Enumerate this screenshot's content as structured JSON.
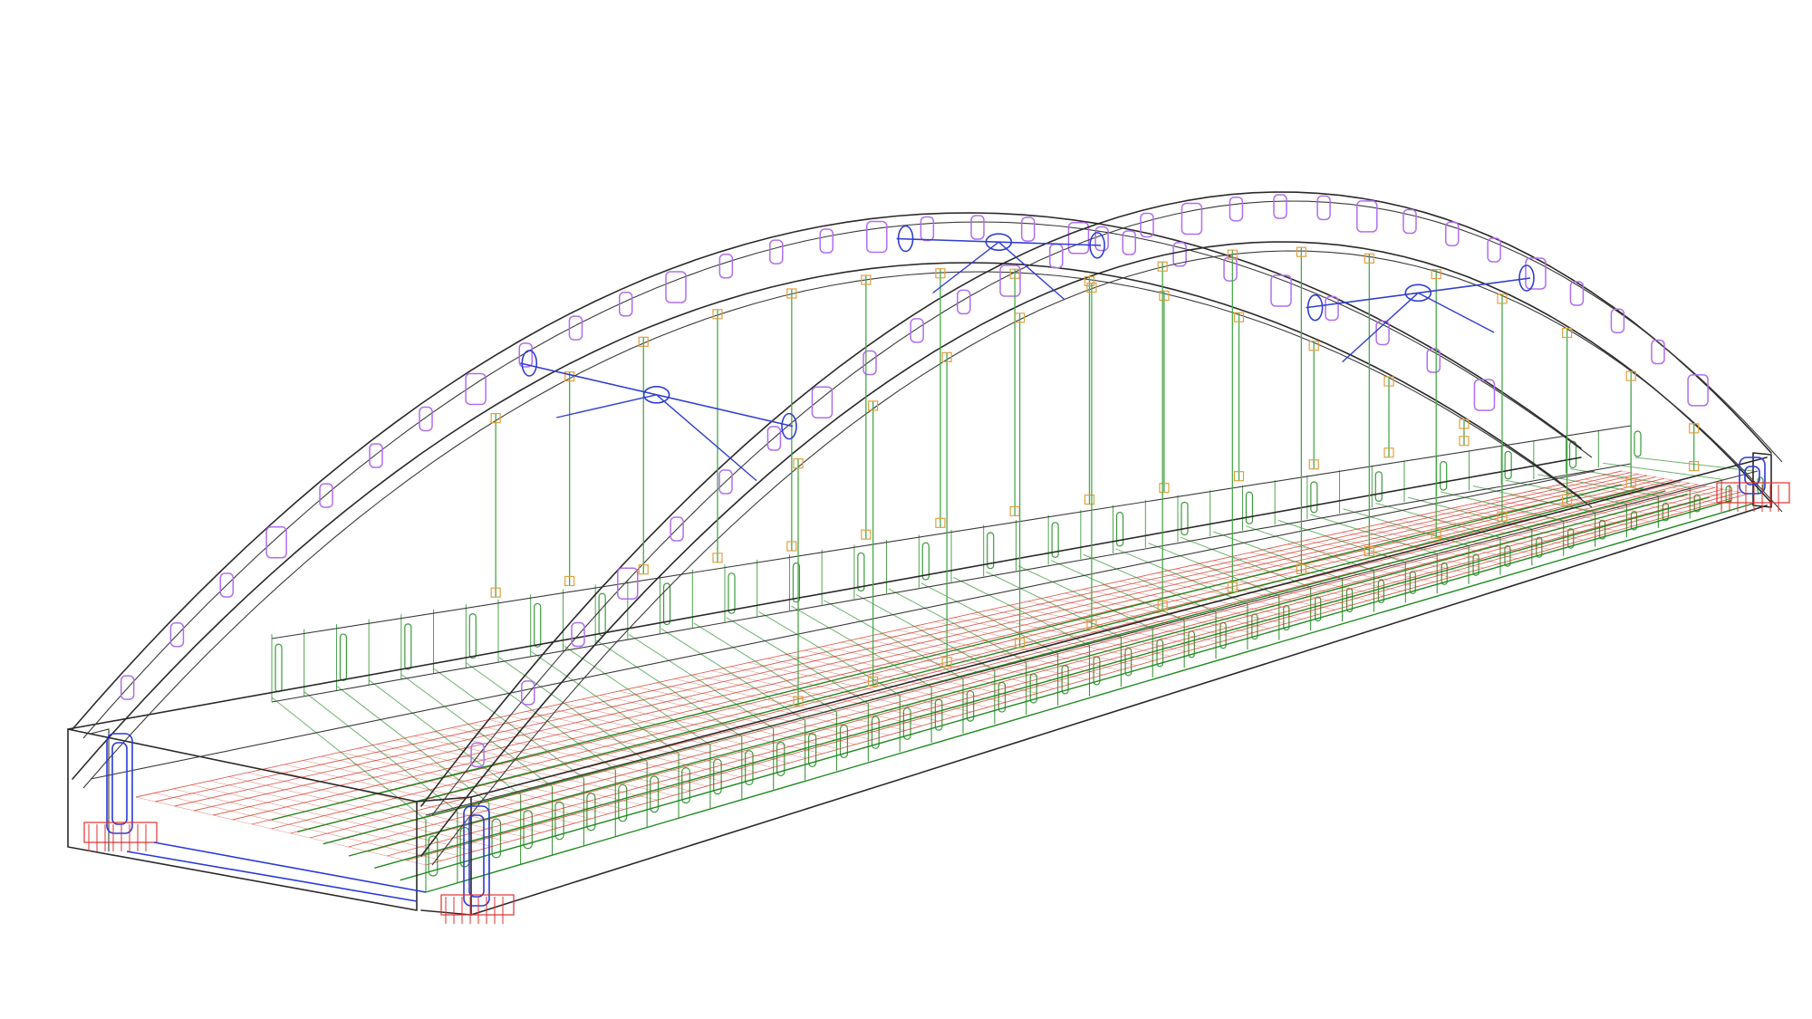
{
  "colors": {
    "background": "#ffffff",
    "outline": "#2a2a2a",
    "arch_stiffeners": "#b06ef0",
    "hangers": "#4aa84a",
    "hanger_anchors": "#e0a040",
    "deck_diaphragms": "#3c9a3c",
    "deck_rebar_red": "#d23a2a",
    "deck_rebar_green": "#1f8a1f",
    "wind_bracing": "#2f3fd0"
  },
  "icons": {
    "left_arch": "arch-rib",
    "right_arch": "arch-rib",
    "hangers": "vertical-hanger",
    "deck": "box-girder-deck",
    "bracing": "portal-bracing"
  }
}
